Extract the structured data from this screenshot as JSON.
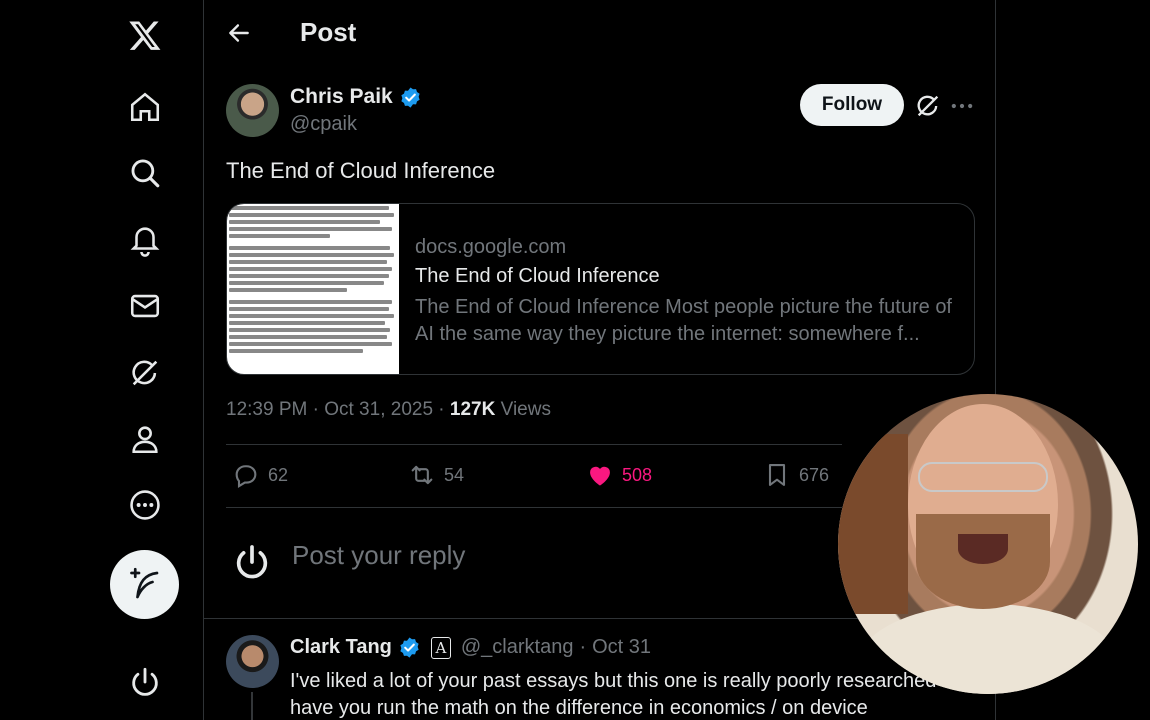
{
  "app": {
    "logo_icon": "x-logo-icon"
  },
  "nav": {
    "items": [
      {
        "name": "home",
        "icon": "home-icon"
      },
      {
        "name": "explore",
        "icon": "search-icon"
      },
      {
        "name": "notifications",
        "icon": "bell-icon"
      },
      {
        "name": "messages",
        "icon": "mail-icon"
      },
      {
        "name": "grok",
        "icon": "grok-icon"
      },
      {
        "name": "profile",
        "icon": "person-icon"
      },
      {
        "name": "more",
        "icon": "more-circle-icon"
      }
    ],
    "compose_icon": "feather-plus-icon",
    "account_icon": "power-icon"
  },
  "header": {
    "title": "Post"
  },
  "post": {
    "author_name": "Chris Paik",
    "author_handle": "@cpaik",
    "follow_label": "Follow",
    "text": "The End of Cloud Inference",
    "card": {
      "domain": "docs.google.com",
      "title": "The End of Cloud Inference",
      "description": "The End of Cloud Inference Most people picture the future of AI the same way they picture the internet: somewhere f..."
    },
    "time": "12:39 PM",
    "date": "Oct 31, 2025",
    "views_count": "127K",
    "views_label": "Views",
    "replies": "62",
    "reposts": "54",
    "likes": "508",
    "bookmarks": "676"
  },
  "reply_box": {
    "placeholder": "Post your reply"
  },
  "comment": {
    "author_name": "Clark Tang",
    "automated_badge": "A",
    "author_handle": "@_clarktang",
    "date": "Oct 31",
    "text": "I've liked a lot of your past essays but this one is really poorly researched - have you run the math on the difference in economics / on device"
  },
  "colors": {
    "accent": "#1d9bf0",
    "like": "#f91880",
    "muted": "#71767b",
    "text": "#e7e9ea",
    "border": "#2f3336"
  }
}
